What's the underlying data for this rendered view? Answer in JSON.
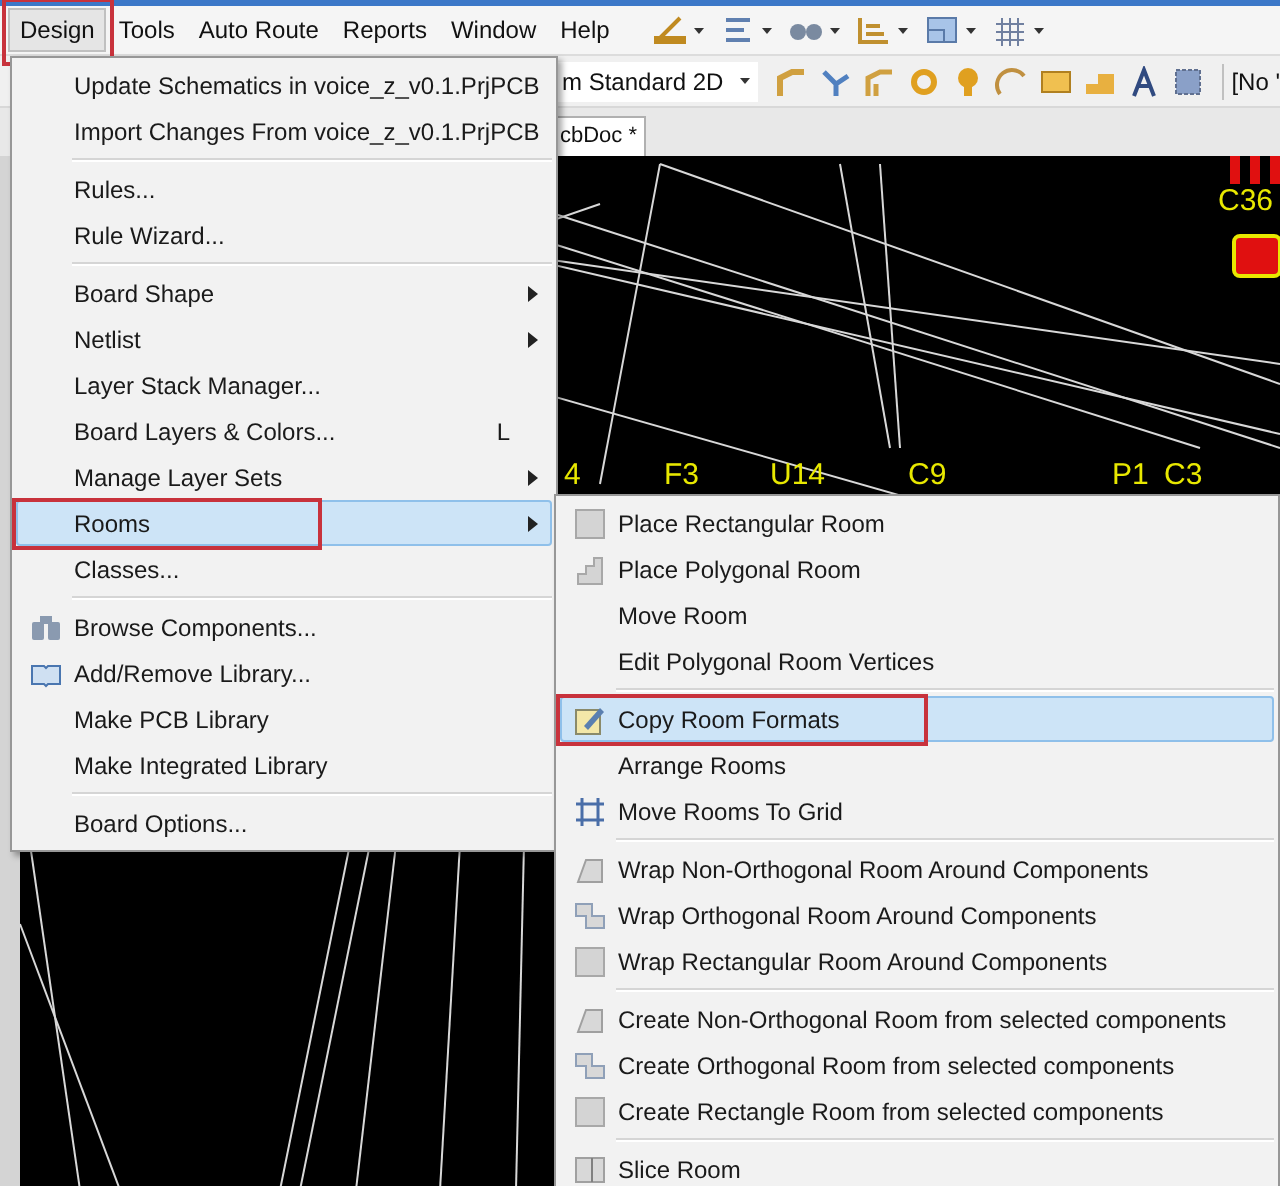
{
  "menubar": [
    {
      "label": "Design",
      "selected": true,
      "annotated": true
    },
    {
      "label": "Tools",
      "selected": false,
      "annotated": false
    },
    {
      "label": "Auto Route",
      "selected": false,
      "annotated": false
    },
    {
      "label": "Reports",
      "selected": false,
      "annotated": false
    },
    {
      "label": "Window",
      "selected": false,
      "annotated": false
    },
    {
      "label": "Help",
      "selected": false,
      "annotated": false
    }
  ],
  "view_combo": {
    "value": "m Standard 2D"
  },
  "toolbar_text": "[No '",
  "document_tab": {
    "label": "cbDoc *"
  },
  "canvas_labels": [
    {
      "text": "C36"
    },
    {
      "text": "4"
    },
    {
      "text": "F3"
    },
    {
      "text": "U14"
    },
    {
      "text": "C9"
    },
    {
      "text": "P1"
    },
    {
      "text": "C3"
    }
  ],
  "design_menu": {
    "groups": [
      [
        {
          "label": "Update Schematics in voice_z_v0.1.PrjPCB",
          "has_submenu": false,
          "selected": false,
          "annotated": false
        },
        {
          "label": "Import Changes From voice_z_v0.1.PrjPCB",
          "has_submenu": false,
          "selected": false,
          "annotated": false
        }
      ],
      [
        {
          "label": "Rules...",
          "has_submenu": false,
          "selected": false,
          "annotated": false
        },
        {
          "label": "Rule Wizard...",
          "has_submenu": false,
          "selected": false,
          "annotated": false
        }
      ],
      [
        {
          "label": "Board Shape",
          "has_submenu": true,
          "selected": false,
          "annotated": false
        },
        {
          "label": "Netlist",
          "has_submenu": true,
          "selected": false,
          "annotated": false
        },
        {
          "label": "Layer Stack Manager...",
          "has_submenu": false,
          "selected": false,
          "annotated": false
        },
        {
          "label": "Board Layers & Colors...",
          "shortcut": "L",
          "has_submenu": false,
          "selected": false,
          "annotated": false
        },
        {
          "label": "Manage Layer Sets",
          "has_submenu": true,
          "selected": false,
          "annotated": false
        },
        {
          "label": "Rooms",
          "has_submenu": true,
          "selected": true,
          "annotated": true
        },
        {
          "label": "Classes...",
          "has_submenu": false,
          "selected": false,
          "annotated": false
        }
      ],
      [
        {
          "label": "Browse Components...",
          "has_submenu": false,
          "selected": false,
          "annotated": false
        },
        {
          "label": "Add/Remove Library...",
          "has_submenu": false,
          "selected": false,
          "annotated": false
        },
        {
          "label": "Make PCB Library",
          "has_submenu": false,
          "selected": false,
          "annotated": false
        },
        {
          "label": "Make Integrated Library",
          "has_submenu": false,
          "selected": false,
          "annotated": false
        }
      ],
      [
        {
          "label": "Board Options...",
          "has_submenu": false,
          "selected": false,
          "annotated": false
        }
      ]
    ]
  },
  "rooms_submenu": {
    "groups": [
      [
        {
          "label": "Place Rectangular Room",
          "selected": false,
          "annotated": false
        },
        {
          "label": "Place Polygonal Room",
          "selected": false,
          "annotated": false
        },
        {
          "label": "Move Room",
          "selected": false,
          "annotated": false
        },
        {
          "label": "Edit Polygonal Room Vertices",
          "selected": false,
          "annotated": false
        }
      ],
      [
        {
          "label": "Copy Room Formats",
          "selected": true,
          "annotated": true
        },
        {
          "label": "Arrange Rooms",
          "selected": false,
          "annotated": false
        },
        {
          "label": "Move Rooms To Grid",
          "selected": false,
          "annotated": false
        }
      ],
      [
        {
          "label": "Wrap Non-Orthogonal Room Around Components",
          "selected": false,
          "annotated": false
        },
        {
          "label": "Wrap Orthogonal Room Around Components",
          "selected": false,
          "annotated": false
        },
        {
          "label": "Wrap Rectangular Room Around Components",
          "selected": false,
          "annotated": false
        }
      ],
      [
        {
          "label": "Create Non-Orthogonal Room from selected components",
          "selected": false,
          "annotated": false
        },
        {
          "label": "Create Orthogonal Room from selected components",
          "selected": false,
          "annotated": false
        },
        {
          "label": "Create Rectangle Room from selected components",
          "selected": false,
          "annotated": false
        }
      ],
      [
        {
          "label": "Slice Room",
          "selected": false,
          "annotated": false
        }
      ]
    ]
  }
}
